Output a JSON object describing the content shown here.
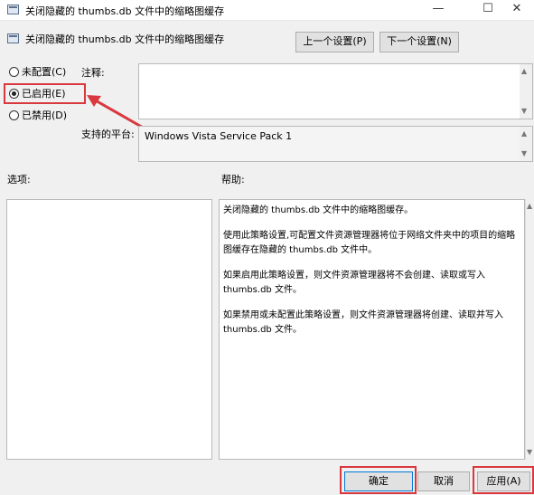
{
  "window": {
    "title": "关闭隐藏的 thumbs.db 文件中的缩略图缓存",
    "minimize_symbol": "—",
    "maximize_symbol": "☐",
    "close_symbol": "✕"
  },
  "header": {
    "policy_title": "关闭隐藏的 thumbs.db 文件中的缩略图缓存",
    "prev_label": "上一个设置(P)",
    "next_label": "下一个设置(N)"
  },
  "radios": [
    {
      "label": "未配置(C)",
      "checked": false
    },
    {
      "label": "已启用(E)",
      "checked": true
    },
    {
      "label": "已禁用(D)",
      "checked": false
    }
  ],
  "comment": {
    "label": "注释:",
    "value": ""
  },
  "platform": {
    "label": "支持的平台:",
    "value": "Windows Vista Service Pack 1"
  },
  "options": {
    "label": "选项:"
  },
  "help": {
    "label": "帮助:",
    "paragraphs": [
      "关闭隐藏的 thumbs.db 文件中的缩略图缓存。",
      "使用此策略设置,可配置文件资源管理器将位于网络文件夹中的项目的缩略图缓存在隐藏的 thumbs.db 文件中。",
      "如果启用此策略设置，则文件资源管理器将不会创建、读取或写入 thumbs.db 文件。",
      "如果禁用或未配置此策略设置，则文件资源管理器将创建、读取并写入 thumbs.db 文件。"
    ]
  },
  "footer": {
    "ok_label": "确定",
    "cancel_label": "取消",
    "apply_label": "应用(A)"
  },
  "colors": {
    "highlight": "#d9383e",
    "window_bg": "#f0f0f0",
    "button_bg": "#e1e1e1",
    "default_button_border": "#0078d7"
  }
}
